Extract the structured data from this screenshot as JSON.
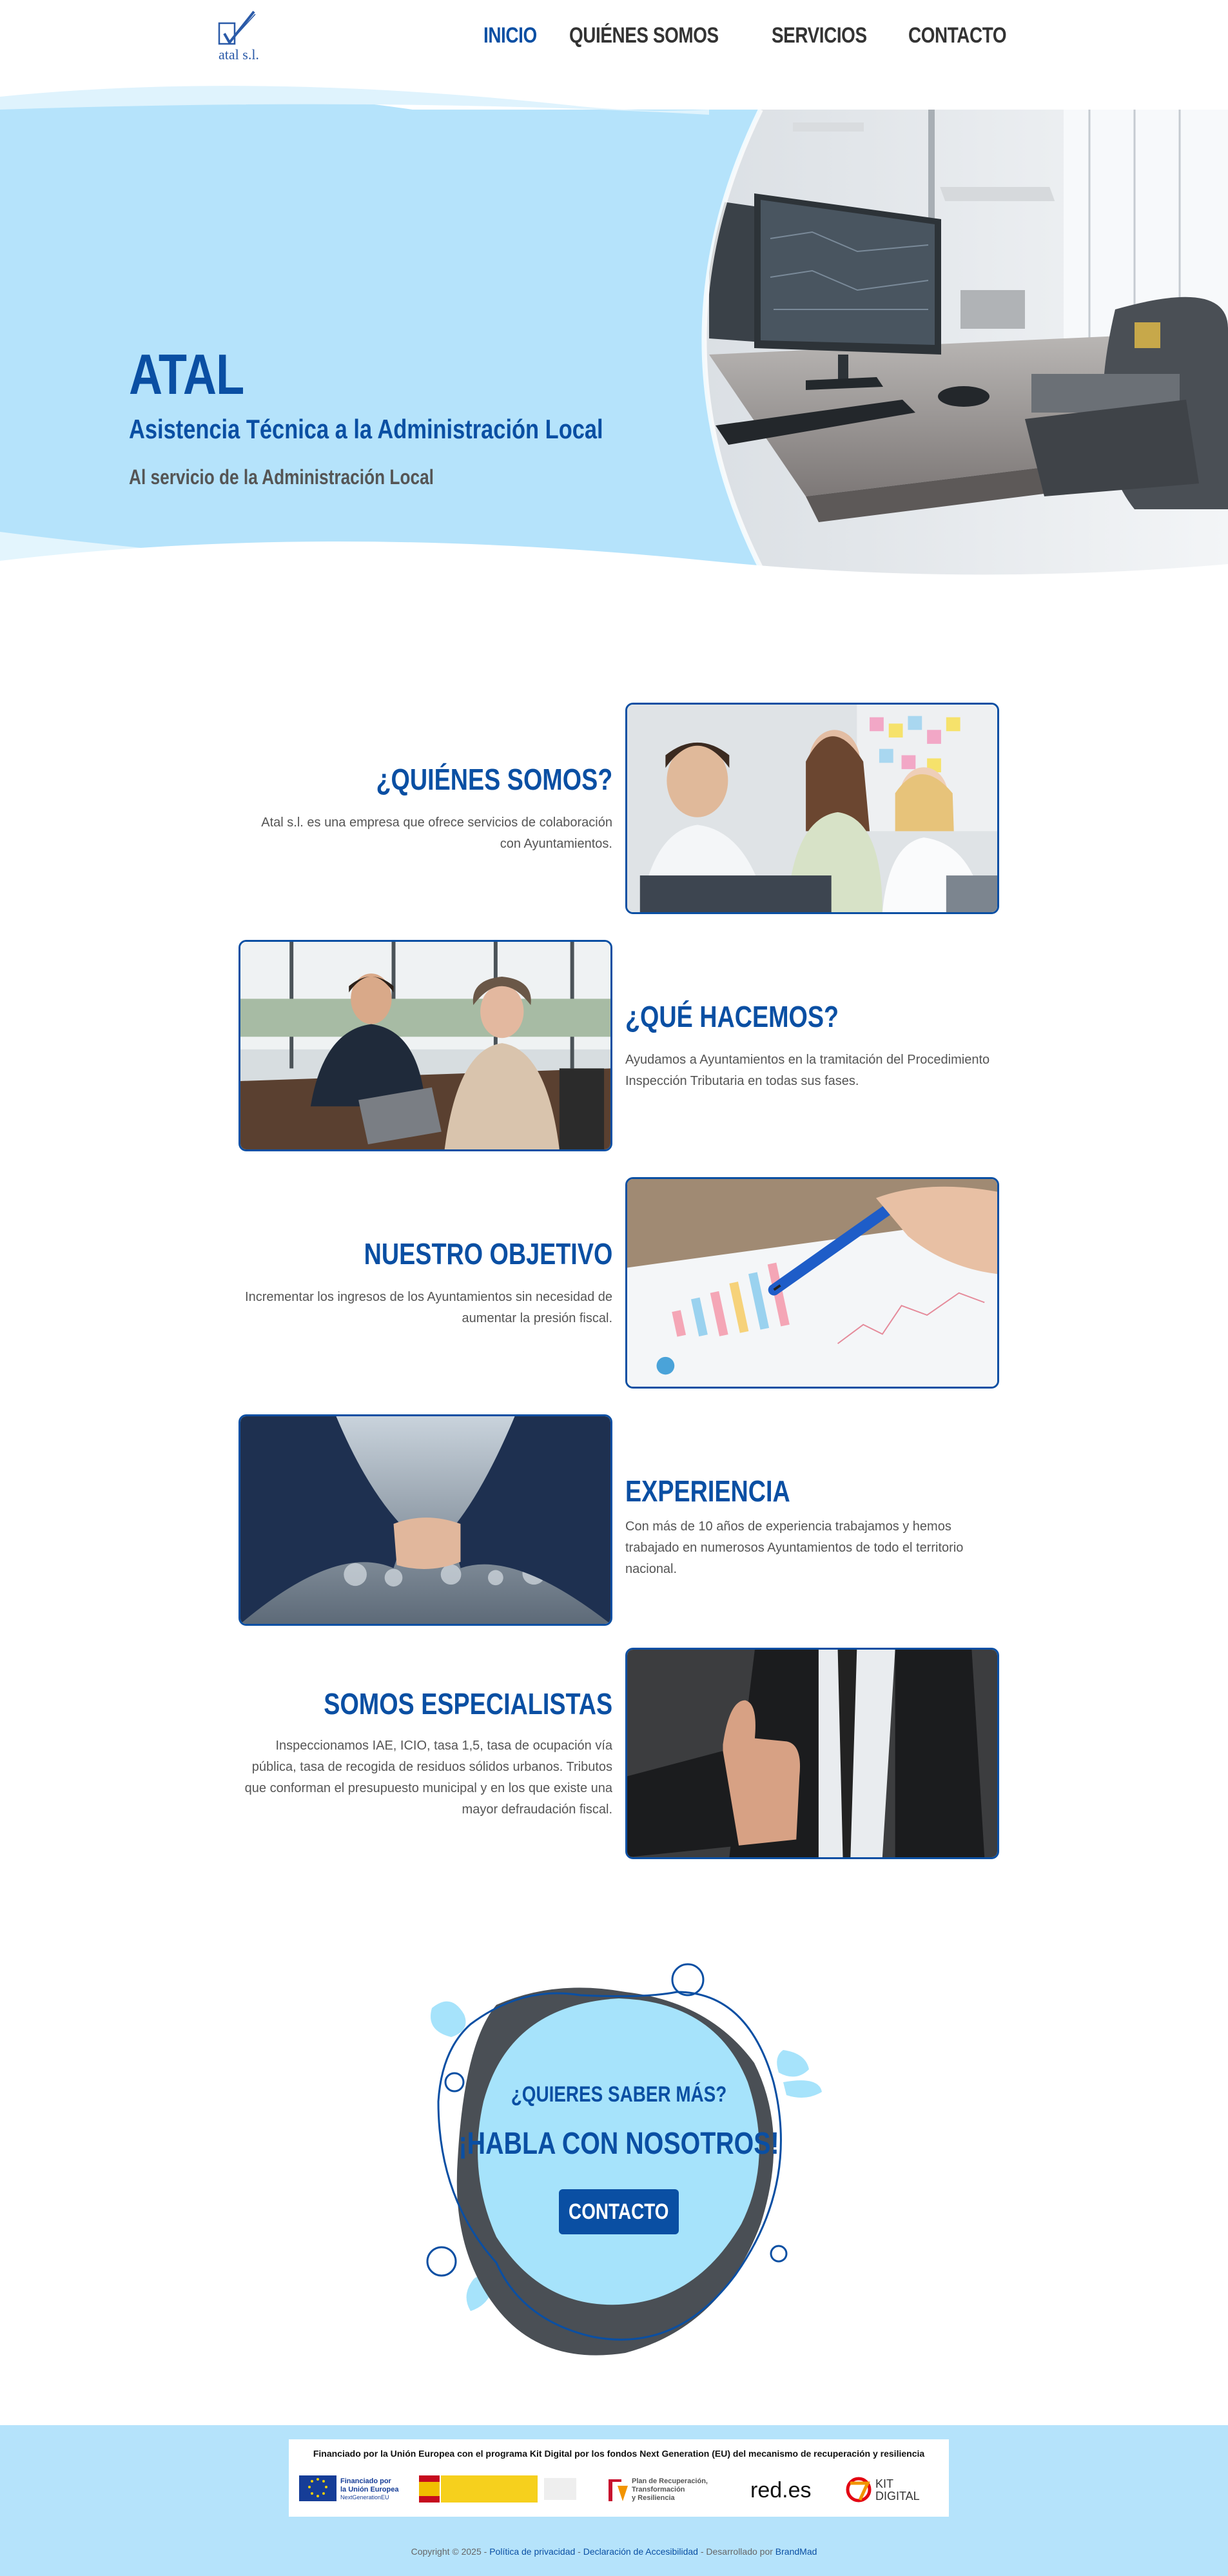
{
  "header": {
    "logo_text": "atal s.l.",
    "nav": [
      "INICIO",
      "QUIÉNES SOMOS",
      "SERVICIOS",
      "CONTACTO"
    ]
  },
  "hero": {
    "title": "ATAL",
    "subtitle": "Asistencia Técnica a la Administración Local",
    "tagline": "Al servicio de la Administración Local"
  },
  "sections": [
    {
      "title": "¿QUIÉNES SOMOS?",
      "text": "Atal s.l. es una empresa que ofrece servicios de colaboración con Ayuntamientos."
    },
    {
      "title": "¿QUÉ HACEMOS?",
      "text": "Ayudamos a Ayuntamientos en la tramitación del Procedimiento Inspección Tributaria en todas sus fases."
    },
    {
      "title": "NUESTRO OBJETIVO",
      "text": "Incrementar los ingresos de los Ayuntamientos sin necesidad de aumentar la presión fiscal."
    },
    {
      "title": "EXPERIENCIA",
      "text": "Con más de 10 años de experiencia trabajamos y hemos trabajado en numerosos Ayuntamientos de todo el territorio nacional."
    },
    {
      "title": "SOMOS ESPECIALISTAS",
      "text": "Inspeccionamos IAE, ICIO, tasa 1,5, tasa de ocupación vía pública, tasa de recogida de residuos sólidos urbanos. Tributos que conforman el presupuesto municipal y en los que existe una mayor defraudación fiscal."
    }
  ],
  "cta": {
    "question": "¿QUIERES SABER MÁS?",
    "headline": "¡HABLA CON NOSOTROS!",
    "button": "CONTACTO"
  },
  "footer": {
    "funding_text": "Financiado por la Unión Europea con el programa Kit Digital por los fondos Next Generation (EU) del mecanismo de recuperación y resiliencia",
    "logos": {
      "eu_line1": "Financiado por",
      "eu_line2": "la Unión Europea",
      "eu_line3": "NextGenerationEU",
      "plan_line1": "Plan de Recuperación,",
      "plan_line2": "Transformación",
      "plan_line3": "y Resiliencia",
      "reds": "red.es",
      "kit_line1": "KIT",
      "kit_line2": "DIGITAL"
    },
    "copyright_prefix": "Copyright © 2025 -",
    "privacy": "Política de privacidad",
    "sep": "-",
    "accessibility": "Declaración de Accesibilidad",
    "dev_prefix": "- Desarrollado por",
    "dev": "BrandMad"
  },
  "colors": {
    "primary": "#0a4fa3",
    "light_blue": "#b5e3fb",
    "cta_blob": "#a6e3fb",
    "dark_blob": "#4a4f55"
  }
}
